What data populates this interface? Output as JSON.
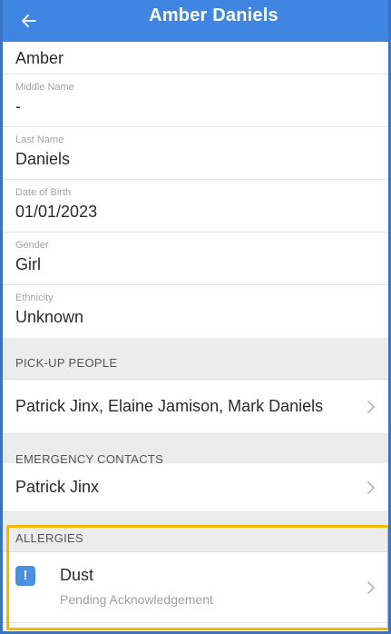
{
  "header": {
    "title": "Amber Daniels",
    "back_icon": "arrow-left-icon",
    "background": "#3f86e2"
  },
  "fields": {
    "first_name_value": "Amber",
    "middle_name": {
      "label": "Middle Name",
      "value": "-"
    },
    "last_name": {
      "label": "Last Name",
      "value": "Daniels"
    },
    "date_of_birth": {
      "label": "Date of Birth",
      "value": "01/01/2023"
    },
    "gender": {
      "label": "Gender",
      "value": "Girl"
    },
    "ethnicity": {
      "label": "Ethnicity",
      "value": "Unknown"
    }
  },
  "pickup": {
    "section_title": "PICK-UP PEOPLE",
    "value": "Patrick Jinx, Elaine Jamison, Mark Daniels"
  },
  "emergency": {
    "section_title": "EMERGENCY CONTACTS",
    "value": "Patrick Jinx"
  },
  "allergies": {
    "section_title": "ALLERGIES",
    "items": [
      {
        "name": "Dust",
        "status": "Pending Acknowledgement",
        "badge": "!",
        "icon": "alert-icon"
      }
    ],
    "highlight_color": "#f5b800"
  }
}
